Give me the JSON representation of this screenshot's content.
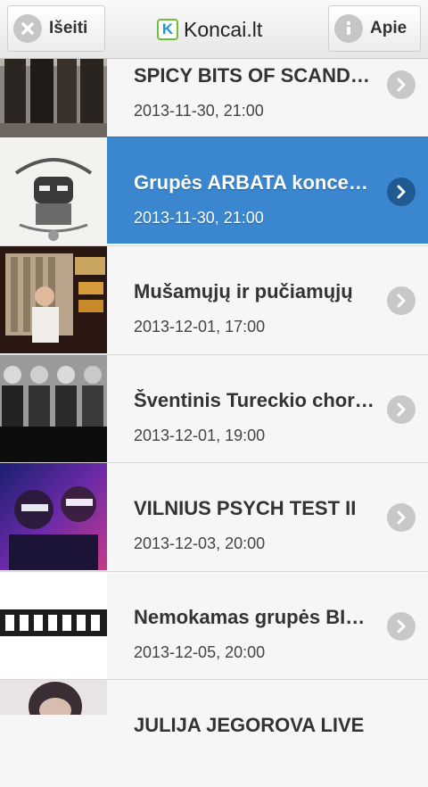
{
  "header": {
    "exit_label": "Išeiti",
    "about_label": "Apie",
    "brand_letter": "K",
    "title": "Koncai.lt"
  },
  "events": [
    {
      "title": "SPICY BITS OF SCANDINAVIA",
      "datetime": "2013-11-30, 21:00",
      "selected": false,
      "thumb": "band-photo"
    },
    {
      "title": "Grupės ARBATA koncertas",
      "datetime": "2013-11-30, 21:00",
      "selected": true,
      "thumb": "arbata-logo"
    },
    {
      "title": "Mušamųjų ir pučiamųjų",
      "datetime": "2013-12-01, 17:00",
      "selected": false,
      "thumb": "conductor-poster"
    },
    {
      "title": "Šventinis Tureckio choras",
      "datetime": "2013-12-01, 19:00",
      "selected": false,
      "thumb": "choir-portraits"
    },
    {
      "title": "VILNIUS PSYCH TEST II",
      "datetime": "2013-12-03, 20:00",
      "selected": false,
      "thumb": "psych-poster"
    },
    {
      "title": "Nemokamas grupės BIGSURAS",
      "datetime": "2013-12-05, 20:00",
      "selected": false,
      "thumb": "bigsuras-logo"
    },
    {
      "title": "JULIJA JEGOROVA LIVE",
      "datetime": "",
      "selected": false,
      "thumb": "singer-photo"
    }
  ],
  "colors": {
    "selected_bg": "#3a87cf",
    "chevron_bg": "#c8c8c8",
    "brand_blue": "#1a9ad8",
    "brand_green": "#6fbf3a"
  }
}
